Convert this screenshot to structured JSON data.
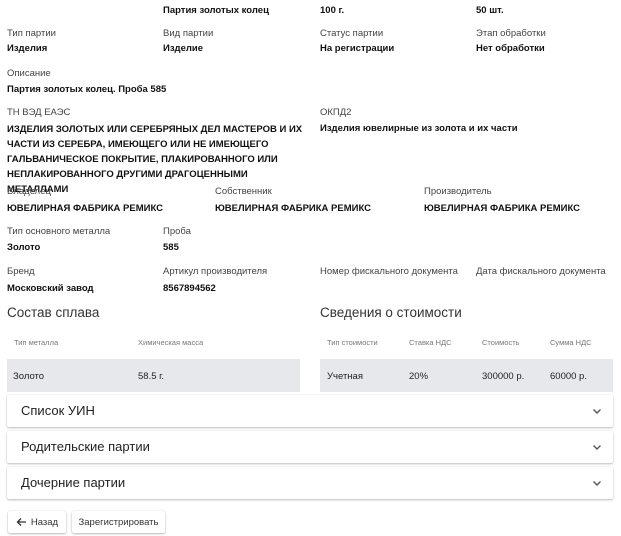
{
  "top_row": {
    "name": "Партия золотых колец",
    "weight": "100 г.",
    "count": "50 шт."
  },
  "fields": {
    "batch_type": {
      "label": "Тип партии",
      "value": "Изделия"
    },
    "item_kind": {
      "label": "Вид партии",
      "value": "Изделие"
    },
    "status": {
      "label": "Статус партии",
      "value": "На регистрации"
    },
    "processing": {
      "label": "Этап обработки",
      "value": "Нет обработки"
    },
    "description": {
      "label": "Описание",
      "value": "Партия золотых колец. Проба 585"
    },
    "tnved": {
      "label": "ТН ВЭД ЕАЭС",
      "value": "ИЗДЕЛИЯ ЗОЛОТЫХ ИЛИ СЕРЕБРЯНЫХ ДЕЛ МАСТЕРОВ И ИХ ЧАСТИ ИЗ СЕРЕБРА, ИМЕЮЩЕГО ИЛИ НЕ ИМЕЮЩЕГО ГАЛЬВАНИЧЕСКОЕ ПОКРЫТИЕ, ПЛАКИРОВАННОГО ИЛИ НЕПЛАКИРОВАННОГО ДРУГИМИ ДРАГОЦЕННЫМИ МЕТАЛЛАМИ"
    },
    "okpd2": {
      "label": "ОКПД2",
      "value": "Изделия ювелирные из золота и их части"
    },
    "holder": {
      "label": "Владелец",
      "value": "ЮВЕЛИРНАЯ ФАБРИКА РЕМИКС"
    },
    "owner": {
      "label": "Собственник",
      "value": "ЮВЕЛИРНАЯ ФАБРИКА РЕМИКС"
    },
    "producer": {
      "label": "Производитель",
      "value": "ЮВЕЛИРНАЯ ФАБРИКА РЕМИКС"
    },
    "metal": {
      "label": "Тип основного металла",
      "value": "Золото"
    },
    "assay": {
      "label": "Проба",
      "value": "585"
    },
    "brand": {
      "label": "Бренд",
      "value": "Московский завод"
    },
    "article": {
      "label": "Артикул производителя",
      "value": "8567894562"
    },
    "fiscal_num": {
      "label": "Номер фискального документа",
      "value": ""
    },
    "fiscal_date": {
      "label": "Дата фискального документа",
      "value": ""
    }
  },
  "alloy": {
    "title": "Состав сплава",
    "headers": [
      "Тип металла",
      "Химическая масса"
    ],
    "rows": [
      [
        "Золото",
        "58.5 г."
      ]
    ]
  },
  "cost": {
    "title": "Сведения о стоимости",
    "headers": [
      "Тип стоимости",
      "Ставка НДС",
      "Стоимость",
      "Сумма НДС"
    ],
    "rows": [
      [
        "Учетная",
        "20%",
        "300000 р.",
        "60000 р."
      ]
    ]
  },
  "accordions": [
    {
      "title": "Список УИН",
      "icon": "chevron-down-icon"
    },
    {
      "title": "Родительские партии",
      "icon": "chevron-down-icon"
    },
    {
      "title": "Дочерние партии",
      "icon": "chevron-down-icon"
    }
  ],
  "buttons": {
    "back": "Назад",
    "back_icon": "arrow-left-icon",
    "register": "Зарегистрировать"
  }
}
